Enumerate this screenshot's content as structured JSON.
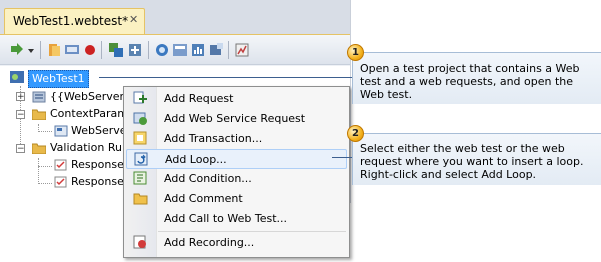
{
  "document_tab": {
    "title": "WebTest1.webtest*",
    "close_glyph": "✕"
  },
  "toolbar": {
    "icons": [
      "run-test-icon",
      "dropdown-arrow-icon",
      "open-icon",
      "parameterize-icon",
      "record-icon",
      "add-request-icon",
      "add-transaction-icon",
      "set-context-icon",
      "generate-code-icon",
      "performance-session-icon",
      "properties-icon",
      "report-icon"
    ]
  },
  "tree": {
    "root": "WebTest1",
    "nodes": [
      {
        "label": "{{WebServer1"
      },
      {
        "label": "ContextParam"
      },
      {
        "label": "WebServe"
      },
      {
        "label": "Validation Ru"
      },
      {
        "label": "Response"
      },
      {
        "label": "Response"
      }
    ]
  },
  "context_menu": {
    "items": [
      {
        "label": "Add Request",
        "icon": "add-request-icon"
      },
      {
        "label": "Add Web Service Request",
        "icon": "add-web-service-request-icon"
      },
      {
        "label": "Add Transaction...",
        "icon": "add-transaction-icon"
      },
      {
        "label": "Add Loop...",
        "icon": "add-loop-icon",
        "highlighted": true
      },
      {
        "label": "Add Condition...",
        "icon": "add-condition-icon"
      },
      {
        "label": "Add Comment",
        "icon": "add-comment-icon"
      },
      {
        "label": "Add Call to Web Test...",
        "icon": "none"
      },
      {
        "label": "Add Recording...",
        "icon": "add-recording-icon"
      }
    ]
  },
  "callouts": [
    {
      "number": "1",
      "lines": [
        "Open a test project that contains a Web",
        "test and a web requests, and open the",
        "Web test."
      ]
    },
    {
      "number": "2",
      "lines": [
        "Select either the web test or the web",
        "request where you want to insert a loop.",
        "Right-click and select Add Loop."
      ]
    }
  ],
  "colors": {
    "tab_bg": "#fbf1c2",
    "tab_border": "#e5c365",
    "selection": "#3399ff",
    "callout_circle": "#f3b21e",
    "leader": "#3d5f8f"
  }
}
